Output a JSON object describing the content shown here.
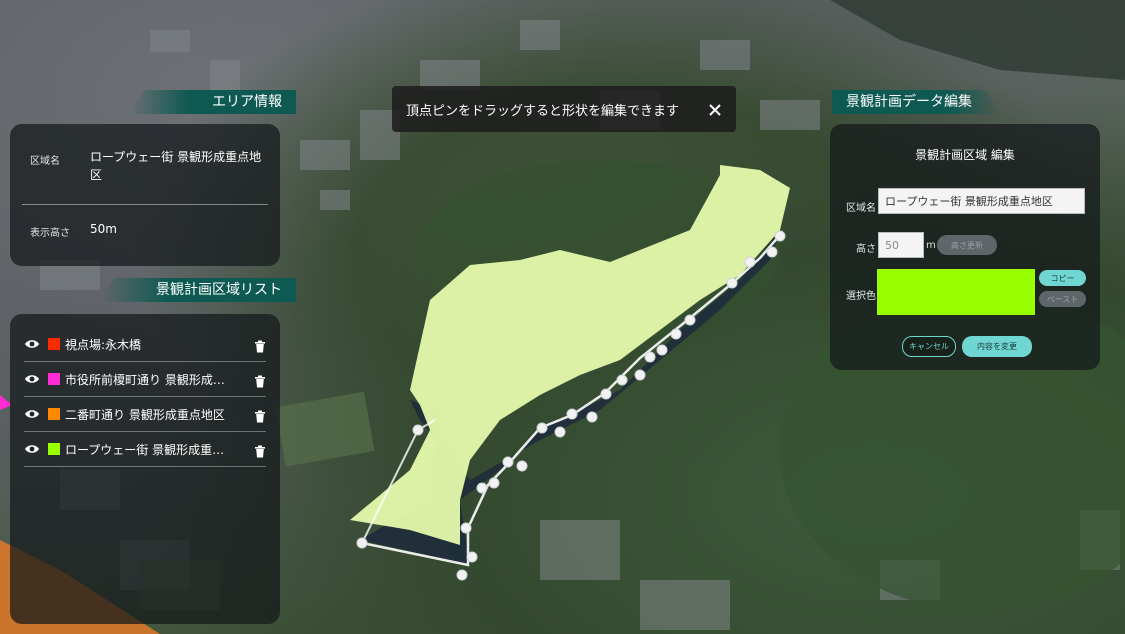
{
  "toast": {
    "text": "頂点ピンをドラッグすると形状を編集できます"
  },
  "area_info": {
    "header": "エリア情報",
    "name_label": "区域名",
    "name_value": "ロープウェー街 景観形成重点地区",
    "height_label": "表示高さ",
    "height_value": "50m"
  },
  "region_list": {
    "header": "景観計画区域リスト",
    "items": [
      {
        "name": "視点場:永木橋",
        "color": "#ff2a00"
      },
      {
        "name": "市役所前榎町通り 景観形成…",
        "color": "#ff2bd4"
      },
      {
        "name": "二番町通り 景観形成重点地区",
        "color": "#ff8a00"
      },
      {
        "name": "ロープウェー街 景観形成重…",
        "color": "#99ff00"
      }
    ]
  },
  "edit_panel": {
    "header": "景観計画データ編集",
    "title": "景観計画区域 編集",
    "name_label": "区域名",
    "name_value": "ロープウェー街 景観形成重点地区",
    "height_label": "高さ",
    "height_value": "50",
    "height_unit": "m",
    "height_update_button": "高さ更新",
    "color_label": "選択色",
    "selected_color": "#99ff00",
    "copy_button": "コピー",
    "paste_button": "ペースト",
    "cancel_button": "キャンセル",
    "apply_button": "内容を変更"
  },
  "colors": {
    "accent_header": "#0e5a52",
    "polygon_fill": "#eaffb0",
    "button_teal": "#6fd6d2"
  },
  "icons": [
    "eye-icon",
    "trash-icon",
    "close-icon"
  ]
}
